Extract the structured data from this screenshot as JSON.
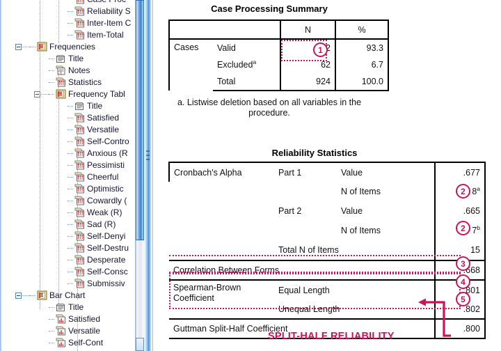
{
  "window": {
    "pane_left": "Output Outline Navigator",
    "pane_right": "Output Viewer"
  },
  "outline": {
    "items": [
      {
        "label": "Case Proc",
        "icon": "table-icon",
        "depth": 3,
        "expander": null
      },
      {
        "label": "Reliability S",
        "icon": "table-icon",
        "depth": 3,
        "expander": null
      },
      {
        "label": "Inter-Item C",
        "icon": "table-icon",
        "depth": 3,
        "expander": null
      },
      {
        "label": "Item-Total",
        "icon": "table-icon",
        "depth": 3,
        "expander": null
      },
      {
        "label": "Frequencies",
        "icon": "output-icon",
        "depth": 1,
        "expander": "collapse"
      },
      {
        "label": "Title",
        "icon": "title-icon",
        "depth": 2,
        "expander": null
      },
      {
        "label": "Notes",
        "icon": "notes-icon",
        "depth": 2,
        "expander": null
      },
      {
        "label": "Statistics",
        "icon": "table-icon",
        "depth": 2,
        "expander": null
      },
      {
        "label": "Frequency Tabl",
        "icon": "output-icon",
        "depth": 2,
        "expander": "collapse"
      },
      {
        "label": "Title",
        "icon": "title-icon",
        "depth": 3,
        "expander": null
      },
      {
        "label": "Satisfied",
        "icon": "table-icon",
        "depth": 3,
        "expander": null
      },
      {
        "label": "Versatile",
        "icon": "table-icon",
        "depth": 3,
        "expander": null
      },
      {
        "label": "Self-Contro",
        "icon": "table-icon",
        "depth": 3,
        "expander": null
      },
      {
        "label": "Anxious (R",
        "icon": "table-icon",
        "depth": 3,
        "expander": null
      },
      {
        "label": "Pessimisti",
        "icon": "table-icon",
        "depth": 3,
        "expander": null
      },
      {
        "label": "Cheerful",
        "icon": "table-icon",
        "depth": 3,
        "expander": null
      },
      {
        "label": "Optimistic",
        "icon": "table-icon",
        "depth": 3,
        "expander": null
      },
      {
        "label": "Cowardly (",
        "icon": "table-icon",
        "depth": 3,
        "expander": null
      },
      {
        "label": "Weak (R)",
        "icon": "table-icon",
        "depth": 3,
        "expander": null
      },
      {
        "label": "Sad (R)",
        "icon": "table-icon",
        "depth": 3,
        "expander": null
      },
      {
        "label": "Self-Denyi",
        "icon": "table-icon",
        "depth": 3,
        "expander": null
      },
      {
        "label": "Self-Destru",
        "icon": "table-icon",
        "depth": 3,
        "expander": null
      },
      {
        "label": "Desperate",
        "icon": "table-icon",
        "depth": 3,
        "expander": null
      },
      {
        "label": "Self-Consc",
        "icon": "table-icon",
        "depth": 3,
        "expander": null
      },
      {
        "label": "Submissiv",
        "icon": "table-icon",
        "depth": 3,
        "expander": null
      },
      {
        "label": "Bar Chart",
        "icon": "output-icon",
        "depth": 1,
        "expander": "collapse"
      },
      {
        "label": "Title",
        "icon": "title-icon",
        "depth": 2,
        "expander": null
      },
      {
        "label": "Satisfied",
        "icon": "chart-icon",
        "depth": 2,
        "expander": null
      },
      {
        "label": "Versatile",
        "icon": "chart-icon",
        "depth": 2,
        "expander": null
      },
      {
        "label": "Self-Cont",
        "icon": "chart-icon",
        "depth": 2,
        "expander": null
      }
    ]
  },
  "case_processing_summary": {
    "title": "Case Processing Summary",
    "col_headers": [
      "",
      "",
      "N",
      "%"
    ],
    "row_group": "Cases",
    "rows": [
      {
        "label": "Valid",
        "sup": "",
        "n": "862",
        "pct": "93.3"
      },
      {
        "label": "Excluded",
        "sup": "a",
        "n": "62",
        "pct": "6.7"
      },
      {
        "label": "Total",
        "sup": "",
        "n": "924",
        "pct": "100.0"
      }
    ],
    "footnote": "a. Listwise deletion based on all variables in the procedure."
  },
  "reliability_statistics": {
    "title": "Reliability Statistics",
    "rows": [
      {
        "c1": "Cronbach's Alpha",
        "c2": "Part 1",
        "c3": "Value",
        "value": ".677",
        "sup": ""
      },
      {
        "c1": "",
        "c2": "",
        "c3": "N of Items",
        "value": "8",
        "sup": "a"
      },
      {
        "c1": "",
        "c2": "Part 2",
        "c3": "Value",
        "value": ".665",
        "sup": ""
      },
      {
        "c1": "",
        "c2": "",
        "c3": "N of Items",
        "value": "7",
        "sup": "b"
      },
      {
        "c1": "",
        "c2": "",
        "c3": "Total N of Items",
        "value": "15",
        "sup": ""
      }
    ],
    "correlation_row": {
      "label": "Correlation Between Forms",
      "value": ".668"
    },
    "spearman_label": "Spearman-Brown Coefficient",
    "spearman_rows": [
      {
        "label": "Equal Length",
        "value": ".801"
      },
      {
        "label": "Unequal Length",
        "value": ".802"
      }
    ],
    "guttman_row": {
      "label": "Guttman Split-Half Coefficient",
      "value": ".800"
    }
  },
  "annotations": {
    "accent_color": "#d1105a",
    "callouts": [
      {
        "number": "1",
        "target": "valid-n-cell"
      },
      {
        "number": "2",
        "target": "part1-n-of-items"
      },
      {
        "number": "2",
        "target": "part2-n-of-items"
      },
      {
        "number": "3",
        "target": "correlation-between-forms"
      },
      {
        "number": "4",
        "target": "spearman-equal-length"
      },
      {
        "number": "5",
        "target": "spearman-unequal-length"
      }
    ],
    "label": "SPLIT-HALF RELIABILITY"
  }
}
